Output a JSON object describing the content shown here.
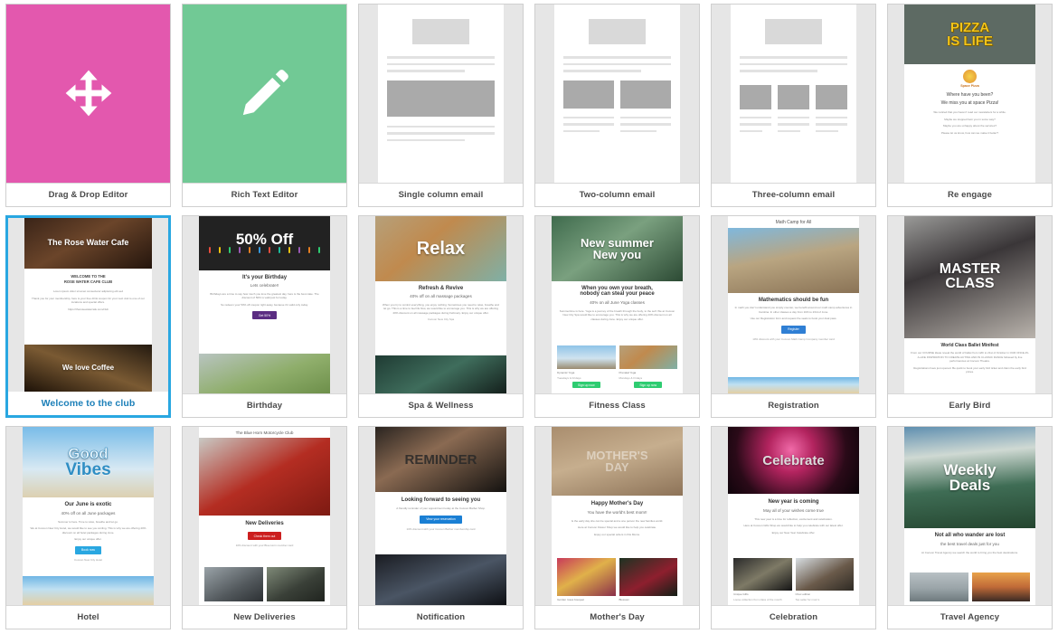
{
  "page": {
    "title": "Email template gallery",
    "selected_template": "Welcome to the club",
    "columns": 6,
    "rows": 3,
    "accent_selected": "#29a7e1",
    "label_color": "#4a4a4a",
    "selected_label_color": "#1b7fb8",
    "card_bg": "#e6e6e6",
    "page_bg": "#ffffff"
  },
  "templates": [
    {
      "label": "Drag & Drop Editor",
      "kind": "editor-tile",
      "tile_color": "#e358ae",
      "icon": "arrows-move-icon",
      "selected": false
    },
    {
      "label": "Rich Text Editor",
      "kind": "editor-tile",
      "tile_color": "#71c995",
      "icon": "pencil-icon",
      "selected": false
    },
    {
      "label": "Single column email",
      "kind": "wireframe",
      "layout": "single",
      "selected": false
    },
    {
      "label": "Two-column email",
      "kind": "wireframe",
      "layout": "two",
      "selected": false
    },
    {
      "label": "Three-column email",
      "kind": "wireframe",
      "layout": "three",
      "selected": false
    },
    {
      "label": "Re engage",
      "kind": "email",
      "selected": false,
      "hero_title_lines": [
        "PIZZA",
        "IS LIFE"
      ],
      "headline": "Where have you been?",
      "subhead": "We miss you at space Pizza!",
      "body_lines": [
        "We noticed that you haven't read our newsletters for a while.",
        "Maybe we stopped bein you in some way?",
        "Maybe you are unhappy about the services?",
        "Please let us know, how can we make it better?"
      ],
      "logo_text": "Space Pizza"
    },
    {
      "label": "Welcome to the club",
      "kind": "email",
      "selected": true,
      "hero_title_lines": [
        "The Rose Water Cafe"
      ],
      "headline_lines": [
        "WELCOME TO THE",
        "ROSE WATER CAFE CLUB"
      ],
      "body_lines": [
        "Lorem ipsum dolor sit amet consectetur adipiscing elit sed",
        "Thank you for your membership, here is your free drink coupon for your next visit to one of our locations and special offers.",
        "https://therosewatercafe.com/club"
      ],
      "footer_title": "We love Coffee"
    },
    {
      "label": "Birthday",
      "kind": "email",
      "selected": false,
      "hero_title_lines": [
        "50% Off"
      ],
      "headline": "It's your Birthday",
      "subhead": "Lets celebrate!!",
      "body_lines": [
        "Birthdays are a time to say how much you love the greatest day, here is the best cake. The discount of 50% is valid just for today.",
        "So redeem your 50% off coupon right away, because it's valid only today."
      ],
      "button": "Get 50%",
      "button_color": "#5b2d82"
    },
    {
      "label": "Spa & Wellness",
      "kind": "email",
      "selected": false,
      "hero_title_lines": [
        "Relax"
      ],
      "headline": "Refresh & Revive",
      "subhead": "40% off on all massage packages",
      "body_lines": [
        "When you try to control everything, you enjoy nothing. Sometimes you need to relax, breathe and let go. This is a time to feel life flow, we would like to encourage you. This is why we are offering 40% discount on all massage packages during February. Enjoy our unique offer."
      ],
      "footer": "Cocoon New City Spa"
    },
    {
      "label": "Fitness Class",
      "kind": "email",
      "selected": false,
      "hero_title_lines": [
        "New summer",
        "New you"
      ],
      "headline_lines": [
        "When you own your breath,",
        "nobody can steal your peace"
      ],
      "subhead": "40% on all June Yoga classes",
      "body_lines": [
        "Summertime is here. Yoga is a journey of the breath through the body, to the self. We at Cocoon New City Spa would like to encourage you. This is why we are offering 40% discount on all classes during June. Enjoy our unique offer."
      ],
      "tiles": [
        {
          "caption": "Dynamic Yoga",
          "sub": "Tuesdays & Fridays",
          "button": "Sign up now"
        },
        {
          "caption": "Prenatal Yoga",
          "sub": "Mondays & Fridays",
          "button": "Sign up now"
        }
      ],
      "button_color": "#2ecc71"
    },
    {
      "label": "Registration",
      "kind": "email",
      "selected": false,
      "top_title": "Math Camp for All",
      "headline": "Mathematics should be fun",
      "body_lines": [
        "In math you don't understand you simply counter, we benefit around our math camp adventures in Carolina. In other classes a day from 10th to 23rd of June.",
        "Use our Registration form and request the seats to book your dual pass."
      ],
      "button": "Register",
      "button_color": "#2f7fd4",
      "footer": "10% discount with your Cocoon Math Camp Company member card"
    },
    {
      "label": "Early Bird",
      "kind": "email",
      "selected": false,
      "hero_title_lines": [
        "MASTER",
        "CLASS"
      ],
      "headline": "World Class Ballet Minifest",
      "body_lines": [
        "From our COURSE Ideas reveal the world of ballet from 12th to 21st of October in OUR ONCE-IN-A-LIFE INSPIRATION TO CREATE ACTING AND IN CLASSIC DANCE followed by live performances at Cocoon Theatre.",
        "Registrations have just opened. Be quick to book your early bird ticket and claim the early bird prices."
      ]
    },
    {
      "label": "Hotel",
      "kind": "email",
      "selected": false,
      "hero_title_lines": [
        "Good",
        "Vibes"
      ],
      "headline": "Our June is exotic",
      "subhead": "40% off on all June packages",
      "body_lines": [
        "Summer is here. Time to relax, breathe and let go.",
        "We at Cocoon New City Hotel, we would like to see you smiling. This is why we are offering 40% discount on all hotel packages during June.",
        "Enjoy our unique offer."
      ],
      "button": "Book now",
      "button_color": "#29a7e1",
      "footer": "Cocoon New City Hotel"
    },
    {
      "label": "New Deliveries",
      "kind": "email",
      "selected": false,
      "top_title": "The Blue Horn Motorcycle Club",
      "headline": "New Deliveries",
      "button": "Check them out",
      "button_color": "#cc1f1f",
      "footer": "10% discount with your Blue Horn member card",
      "tiles": [
        {
          "caption": "",
          "sub": ""
        },
        {
          "caption": "",
          "sub": ""
        }
      ]
    },
    {
      "label": "Notification",
      "kind": "email",
      "selected": false,
      "hero_title_lines": [
        "REMINDER"
      ],
      "headline": "Looking forward to seeing you",
      "body_lines": [
        "A friendly reminder of your appointment today at the Cocoon Barber Shop."
      ],
      "button": "View  your reservation",
      "button_color": "#1a7fd4",
      "footer": "10% discount with your Cocoon Barber membership card"
    },
    {
      "label": "Mother's Day",
      "kind": "email",
      "selected": false,
      "hero_title_lines": [
        "MOTHER'S",
        "DAY"
      ],
      "headline": "Happy Mother's Day",
      "subhead": "You have the world's best mom!!",
      "body_lines": [
        "Is the early day she can be special and a one person the new families world.",
        "Here at Cocoon Flower Shop we would like to help you celebrate.",
        "Enjoy our special orders in this Mums."
      ],
      "tiles": [
        {
          "caption": "Gorden roses bouquet",
          "sub": ""
        },
        {
          "caption": "Blossom",
          "sub": ""
        }
      ]
    },
    {
      "label": "Celebration",
      "kind": "email",
      "selected": false,
      "hero_title_lines": [
        "Celebrate"
      ],
      "headline": "New year is coming",
      "subhead": "May all of your wishes come true",
      "body_lines": [
        "This new year is a time for reflection, excitement and celebration.",
        "Here at Cocoon Gifts Shop we would like to help you celebrate with our latest offer.",
        "Enjoy our New Year Celebrate offer."
      ],
      "tiles": [
        {
          "caption": "Unique Gifts",
          "sub": "Loose collection from class of the month"
        },
        {
          "caption": "Choc edition",
          "sub": "Top seller for mom's"
        }
      ]
    },
    {
      "label": "Travel Agency",
      "kind": "email",
      "selected": false,
      "hero_title_lines": [
        "Weekly",
        "Deals"
      ],
      "headline": "Not all who wander are lost",
      "subhead": "the best travel deals just for you",
      "body_lines": [
        "At Cocoon Travel Agency we search the world to bring you the best destinations."
      ],
      "tiles": [
        {
          "caption": "",
          "sub": ""
        },
        {
          "caption": "",
          "sub": ""
        }
      ]
    }
  ]
}
